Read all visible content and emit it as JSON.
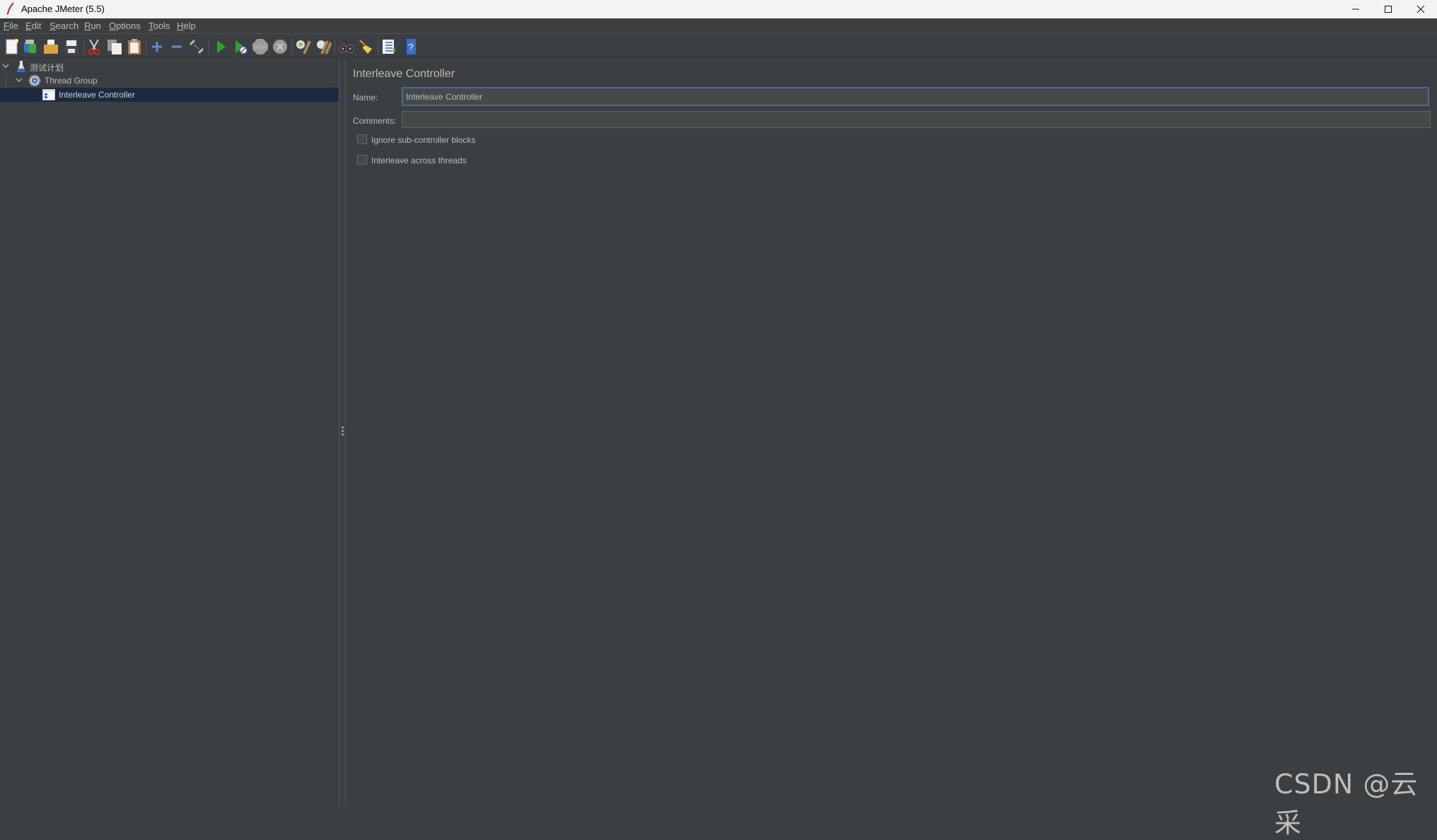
{
  "window": {
    "title": "Apache JMeter (5.5)",
    "controls": {
      "minimize": "–",
      "maximize": "☐",
      "close": "✕"
    }
  },
  "menubar": {
    "items": [
      {
        "label": "File",
        "mnemonic": "F",
        "rest": "ile"
      },
      {
        "label": "Edit",
        "mnemonic": "E",
        "rest": "dit"
      },
      {
        "label": "Search",
        "mnemonic": "S",
        "rest": "earch"
      },
      {
        "label": "Run",
        "mnemonic": "R",
        "rest": "un"
      },
      {
        "label": "Options",
        "mnemonic": "O",
        "rest": "ptions"
      },
      {
        "label": "Tools",
        "mnemonic": "T",
        "rest": "ools"
      },
      {
        "label": "Help",
        "mnemonic": "H",
        "rest": "elp"
      }
    ]
  },
  "toolbar": {
    "buttons": [
      {
        "icon": "new-icon",
        "tooltip": "New"
      },
      {
        "icon": "templates-icon",
        "tooltip": "Templates"
      },
      {
        "icon": "open-icon",
        "tooltip": "Open"
      },
      {
        "icon": "save-icon",
        "tooltip": "Save"
      },
      {
        "icon": "cut-icon",
        "tooltip": "Cut"
      },
      {
        "icon": "copy-icon",
        "tooltip": "Copy"
      },
      {
        "icon": "paste-icon",
        "tooltip": "Paste"
      },
      {
        "icon": "expand-icon",
        "tooltip": "Expand All"
      },
      {
        "icon": "collapse-icon",
        "tooltip": "Collapse All"
      },
      {
        "icon": "toggle-icon",
        "tooltip": "Toggle"
      },
      {
        "icon": "start-icon",
        "tooltip": "Start"
      },
      {
        "icon": "start-no-pauses-icon",
        "tooltip": "Start no pauses"
      },
      {
        "icon": "stop-icon",
        "tooltip": "Stop"
      },
      {
        "icon": "shutdown-icon",
        "tooltip": "Shutdown"
      },
      {
        "icon": "clear-icon",
        "tooltip": "Clear"
      },
      {
        "icon": "clear-all-icon",
        "tooltip": "Clear All"
      },
      {
        "icon": "search-icon",
        "tooltip": "Search"
      },
      {
        "icon": "reset-search-icon",
        "tooltip": "Reset Search"
      },
      {
        "icon": "function-helper-icon",
        "tooltip": "Function Helper Dialog"
      },
      {
        "icon": "help-icon",
        "tooltip": "Help"
      }
    ],
    "stop_label": "STOP"
  },
  "tree": {
    "nodes": [
      {
        "label": "测试计划",
        "type": "test-plan",
        "expanded": true,
        "selected": false
      },
      {
        "label": "Thread Group",
        "type": "thread-group",
        "expanded": true,
        "selected": false
      },
      {
        "label": "Interleave Controller",
        "type": "interleave-controller",
        "selected": true
      }
    ]
  },
  "panel": {
    "title": "Interleave Controller",
    "name_label": "Name:",
    "name_value": "Interleave Controller",
    "comments_label": "Comments:",
    "comments_value": "",
    "options": [
      {
        "label": "Ignore sub-controller blocks",
        "checked": false
      },
      {
        "label": "Interleave across threads",
        "checked": false
      }
    ]
  },
  "colors": {
    "background": "#3c3f41",
    "selection": "#1b2a41",
    "focus_border": "#466d94",
    "text": "#bbbbbb"
  },
  "watermark": "CSDN @云采"
}
